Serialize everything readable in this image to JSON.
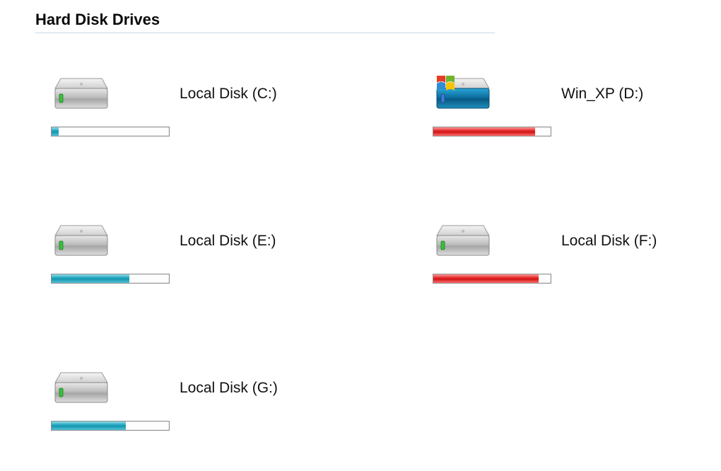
{
  "section": {
    "title": "Hard Disk Drives"
  },
  "drives": [
    {
      "label": "Local Disk (C:)",
      "fill_percent": 6,
      "fill_color": "teal",
      "icon": "disk",
      "led": "green"
    },
    {
      "label": "Win_XP (D:)",
      "fill_percent": 87,
      "fill_color": "red",
      "icon": "disk-windows",
      "led": "blue"
    },
    {
      "label": "Local Disk (E:)",
      "fill_percent": 66,
      "fill_color": "teal",
      "icon": "disk",
      "led": "green"
    },
    {
      "label": "Local Disk (F:)",
      "fill_percent": 90,
      "fill_color": "red",
      "icon": "disk",
      "led": "green"
    },
    {
      "label": "Local Disk (G:)",
      "fill_percent": 63,
      "fill_color": "teal",
      "icon": "disk",
      "led": "green"
    }
  ]
}
